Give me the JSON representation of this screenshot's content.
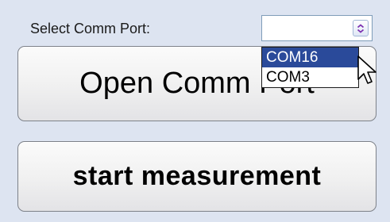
{
  "comm_port": {
    "label": "Select Comm Port:",
    "selected_value": "",
    "options": [
      "COM16",
      "COM3"
    ],
    "highlighted_option": "COM16"
  },
  "buttons": {
    "open_comm_port": "Open Comm Port",
    "start_measurement": "start measurement"
  },
  "colors": {
    "background": "#dde4f1",
    "highlight": "#2a4a9a",
    "arrow_icon": "#7a2fb0"
  },
  "icons": {
    "select_arrow": "chevron-up-down-icon",
    "cursor": "mouse-pointer-icon"
  }
}
